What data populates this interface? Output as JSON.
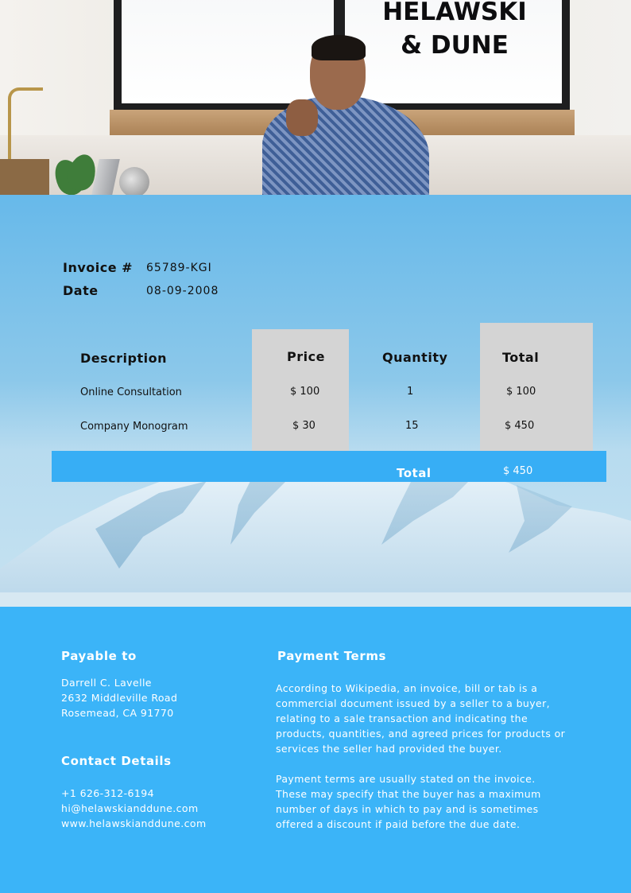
{
  "brand": {
    "line1": "HELAWSKI",
    "line2": "& DUNE"
  },
  "invoice": {
    "number_label": "Invoice #",
    "number_value": "65789-KGI",
    "date_label": "Date",
    "date_value": "08-09-2008"
  },
  "table": {
    "headers": {
      "description": "Description",
      "price": "Price",
      "quantity": "Quantity",
      "total": "Total"
    },
    "rows": [
      {
        "description": "Online Consultation",
        "price": "$ 100",
        "quantity": "1",
        "total": "$ 100"
      },
      {
        "description": "Company Monogram",
        "price": "$ 30",
        "quantity": "15",
        "total": "$ 450"
      }
    ],
    "grand_total_label": "Total",
    "grand_total_value": "$ 450"
  },
  "payable": {
    "heading": "Payable to",
    "name": "Darrell C. Lavelle",
    "street": "2632 Middleville Road",
    "city": "Rosemead, CA 91770"
  },
  "contact": {
    "heading": "Contact Details",
    "phone": "+1 626-312-6194",
    "email": "hi@helawskianddune.com",
    "website": "www.helawskianddune.com"
  },
  "terms": {
    "heading": "Payment Terms",
    "paragraph1": "According to Wikipedia, an invoice, bill or tab is a commercial document issued by a seller to a buyer, relating to a sale transaction and indicating the products, quantities, and agreed prices for products or services the seller had provided the buyer.",
    "paragraph2": "Payment terms are usually stated on the invoice. These may specify that the buyer has a maximum number of days in which to pay and is sometimes offered a discount if paid before the due date."
  },
  "colors": {
    "accent_blue": "#3bb4f8",
    "table_column_gray": "#d4d4d4"
  }
}
